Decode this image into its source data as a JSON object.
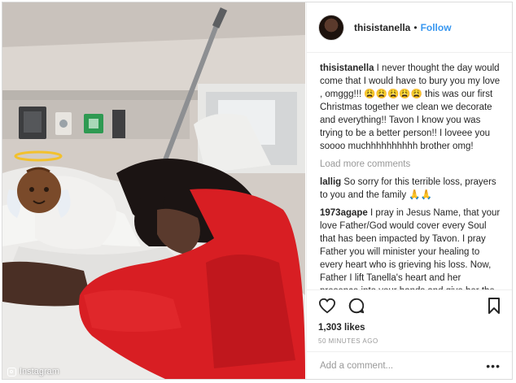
{
  "post": {
    "username": "thisistanella",
    "follow_label": "Follow",
    "separator": "•",
    "caption": "I never thought the day would come that I would have to bury you my love , omggg!!! 😩😩😩😩😩 this was our first Christmas together we clean we decorate and everything!! Tavon I know you was trying to be a better person!! I loveee you soooo muchhhhhhhhhh brother omg!",
    "load_more": "Load more comments",
    "comments": [
      {
        "user": "lallig",
        "text": "So sorry for this terrible loss, prayers to you and the family 🙏🙏"
      },
      {
        "user": "1973agape",
        "text": "I pray in Jesus Name, that your love Father/God would cover every Soul that has been impacted by Tavon. I pray Father you will minister your healing to every heart who is grieving his loss. Now, Father I lift Tanella's heart and her presence into your hands and give her the love she needs. I pray Father that your love will"
      }
    ],
    "likes": "1,303 likes",
    "time": "50 MINUTES AGO",
    "add_comment_placeholder": "Add a comment...",
    "more_glyph": "•••",
    "watermark": "Instagram"
  },
  "icons": {
    "like": "heart-icon",
    "comment": "comment-icon",
    "save": "bookmark-icon",
    "angel_emoji": "baby-angel-emoji"
  },
  "colors": {
    "link": "#3897f0",
    "text": "#262626",
    "muted": "#999999",
    "sweater": "#d81e23"
  }
}
